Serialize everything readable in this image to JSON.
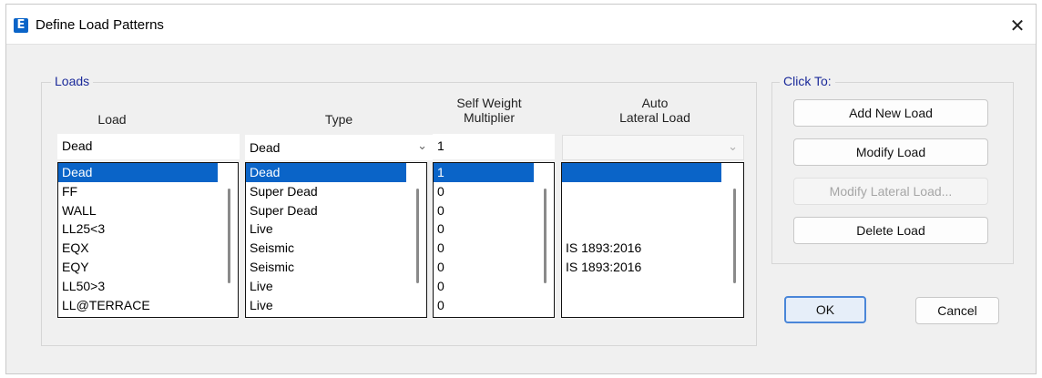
{
  "window": {
    "title": "Define Load Patterns",
    "app_icon_letter": "E",
    "close_glyph": "✕"
  },
  "loads": {
    "legend": "Loads",
    "headers": {
      "load": "Load",
      "type": "Type",
      "self_weight_line1": "Self Weight",
      "self_weight_line2": "Multiplier",
      "auto_line1": "Auto",
      "auto_line2": "Lateral Load"
    },
    "inputs": {
      "load_name": "Dead",
      "type_selected": "Dead",
      "self_weight": "1",
      "auto_lateral_selected": ""
    },
    "rows": [
      {
        "load": "Dead",
        "type": "Dead",
        "multiplier": "1",
        "auto": ""
      },
      {
        "load": "FF",
        "type": "Super Dead",
        "multiplier": "0",
        "auto": ""
      },
      {
        "load": "WALL",
        "type": "Super Dead",
        "multiplier": "0",
        "auto": ""
      },
      {
        "load": "LL25<3",
        "type": "Live",
        "multiplier": "0",
        "auto": ""
      },
      {
        "load": "EQX",
        "type": "Seismic",
        "multiplier": "0",
        "auto": "IS 1893:2016"
      },
      {
        "load": "EQY",
        "type": "Seismic",
        "multiplier": "0",
        "auto": "IS 1893:2016"
      },
      {
        "load": "LL50>3",
        "type": "Live",
        "multiplier": "0",
        "auto": ""
      },
      {
        "load": "LL@TERRACE",
        "type": "Live",
        "multiplier": "0",
        "auto": ""
      }
    ],
    "selected_index": 0
  },
  "click_to": {
    "legend": "Click To:",
    "add_new_load": "Add New Load",
    "modify_load": "Modify Load",
    "modify_lateral_load": "Modify Lateral Load...",
    "delete_load": "Delete Load"
  },
  "footer": {
    "ok": "OK",
    "cancel": "Cancel"
  },
  "colors": {
    "selection": "#0a64c8",
    "legend_text": "#1b2a9a",
    "ok_border": "#4a86d8"
  },
  "icons": {
    "chevron": "chevron-down-icon",
    "close": "close-icon",
    "app": "app-icon"
  }
}
